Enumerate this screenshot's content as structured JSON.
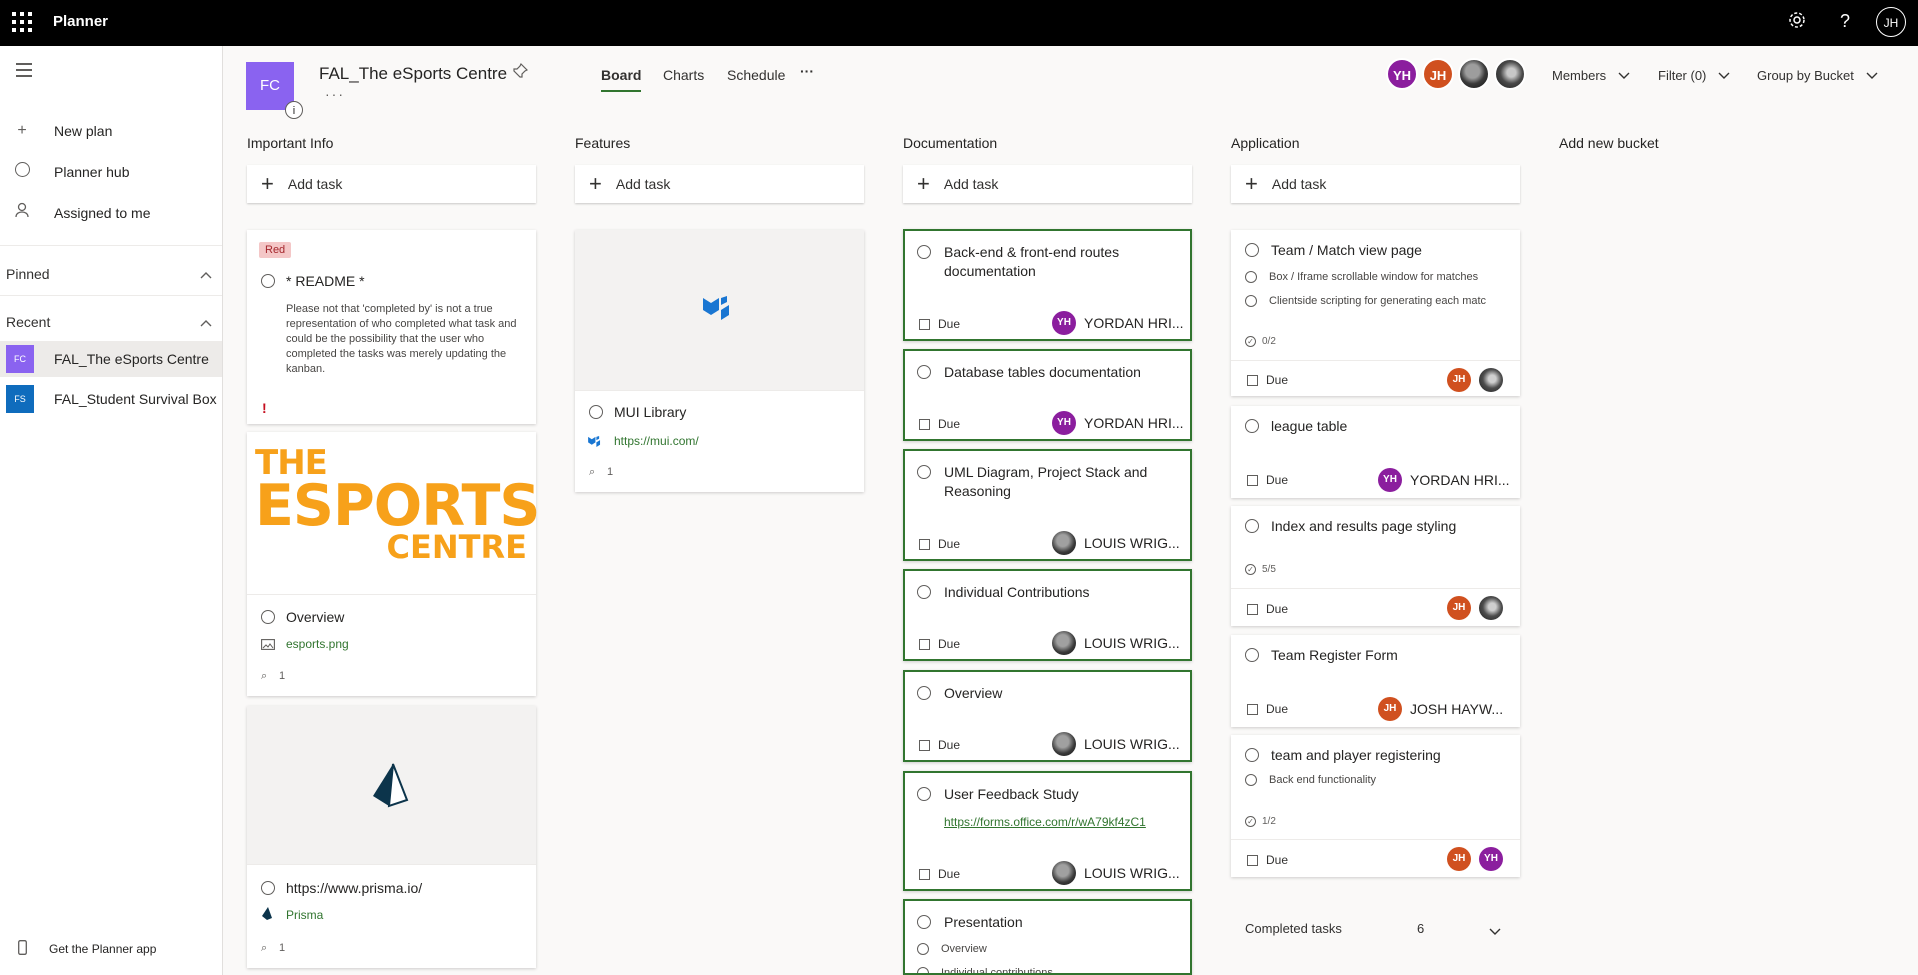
{
  "topbar": {
    "app_title": "Planner",
    "user_initials": "JH",
    "help_glyph": "?"
  },
  "sidebar": {
    "items": [
      {
        "label": "New plan",
        "icon": "plus-icon"
      },
      {
        "label": "Planner hub",
        "icon": "circle-icon"
      },
      {
        "label": "Assigned to me",
        "icon": "person-icon"
      }
    ],
    "pinned_label": "Pinned",
    "recent_label": "Recent",
    "recent": [
      {
        "initials": "FC",
        "label": "FAL_The eSports Centre",
        "color": "#8a63f0"
      },
      {
        "initials": "FS",
        "label": "FAL_Student Survival Box",
        "color": "#0f6cbd"
      }
    ],
    "get_app": "Get the Planner app"
  },
  "header": {
    "plan_initials": "FC",
    "info_glyph": "i",
    "plan_name": "FAL_The eSports Centre",
    "tabs": [
      "Board",
      "Charts",
      "Schedule"
    ],
    "more": "···",
    "avatars": [
      "YH",
      "JH"
    ],
    "members": "Members",
    "filter": "Filter (0)",
    "group_by": "Group by Bucket"
  },
  "board": {
    "add_task": "Add task",
    "add_bucket": "Add new bucket",
    "buckets": [
      {
        "title": "Important Info",
        "cards": [
          {
            "label": "Red",
            "title": "* README *",
            "description": "Please not that 'completed by' is not a true representation of who completed what task and could be the possibility that the user who completed the tasks was merely updating the kanban.",
            "priority": "!"
          },
          {
            "title": "Overview",
            "attachment": "esports.png",
            "attach_count": "1",
            "image_lines": [
              "THE",
              "ESPORTS",
              "CENTRE"
            ]
          },
          {
            "title": "https://www.prisma.io/",
            "attachment": "Prisma",
            "attach_count": "1"
          }
        ]
      },
      {
        "title": "Features",
        "cards": [
          {
            "title": "MUI Library",
            "link": "https://mui.com/",
            "attach_count": "1"
          }
        ]
      },
      {
        "title": "Documentation",
        "cards": [
          {
            "title": "Back-end & front-end routes documentation",
            "due": "Due",
            "assignee": "YORDAN HRI...",
            "initials": "YH"
          },
          {
            "title": "Database tables documentation",
            "due": "Due",
            "assignee": "YORDAN HRI...",
            "initials": "YH"
          },
          {
            "title": "UML Diagram, Project Stack and Reasoning",
            "due": "Due",
            "assignee": "LOUIS WRIG..."
          },
          {
            "title": "Individual Contributions",
            "due": "Due",
            "assignee": "LOUIS WRIG..."
          },
          {
            "title": "Overview",
            "due": "Due",
            "assignee": "LOUIS WRIG..."
          },
          {
            "title": "User Feedback Study",
            "link": "https://forms.office.com/r/wA79kf4zC1",
            "due": "Due",
            "assignee": "LOUIS WRIG..."
          },
          {
            "title": "Presentation",
            "checklist": [
              "Overview",
              "Individual contributions"
            ]
          }
        ]
      },
      {
        "title": "Application",
        "cards": [
          {
            "title": "Team / Match view page",
            "checklist": [
              "Box / Iframe scrollable window for matches",
              "Clientside scripting for generating each matc"
            ],
            "progress": "0/2",
            "due": "Due",
            "initials": [
              "JH"
            ]
          },
          {
            "title": "league table",
            "due": "Due",
            "assignee": "YORDAN HRI...",
            "initials": "YH"
          },
          {
            "title": "Index and results page styling",
            "progress": "5/5",
            "due": "Due",
            "initials": [
              "JH"
            ]
          },
          {
            "title": "Team Register Form",
            "due": "Due",
            "assignee": "JOSH HAYW...",
            "initials": "JH"
          },
          {
            "title": "team and player registering",
            "checklist": [
              "Back end functionality"
            ],
            "progress": "1/2",
            "due": "Due",
            "initials": [
              "JH",
              "YH"
            ]
          }
        ],
        "completed_label": "Completed tasks",
        "completed_count": "6"
      }
    ]
  },
  "colors": {
    "accent": "#31752f",
    "yh": "#8b1e9e",
    "jh": "#d0501f",
    "plan": "#8a63f0",
    "label_red": "#f4c7c7"
  }
}
